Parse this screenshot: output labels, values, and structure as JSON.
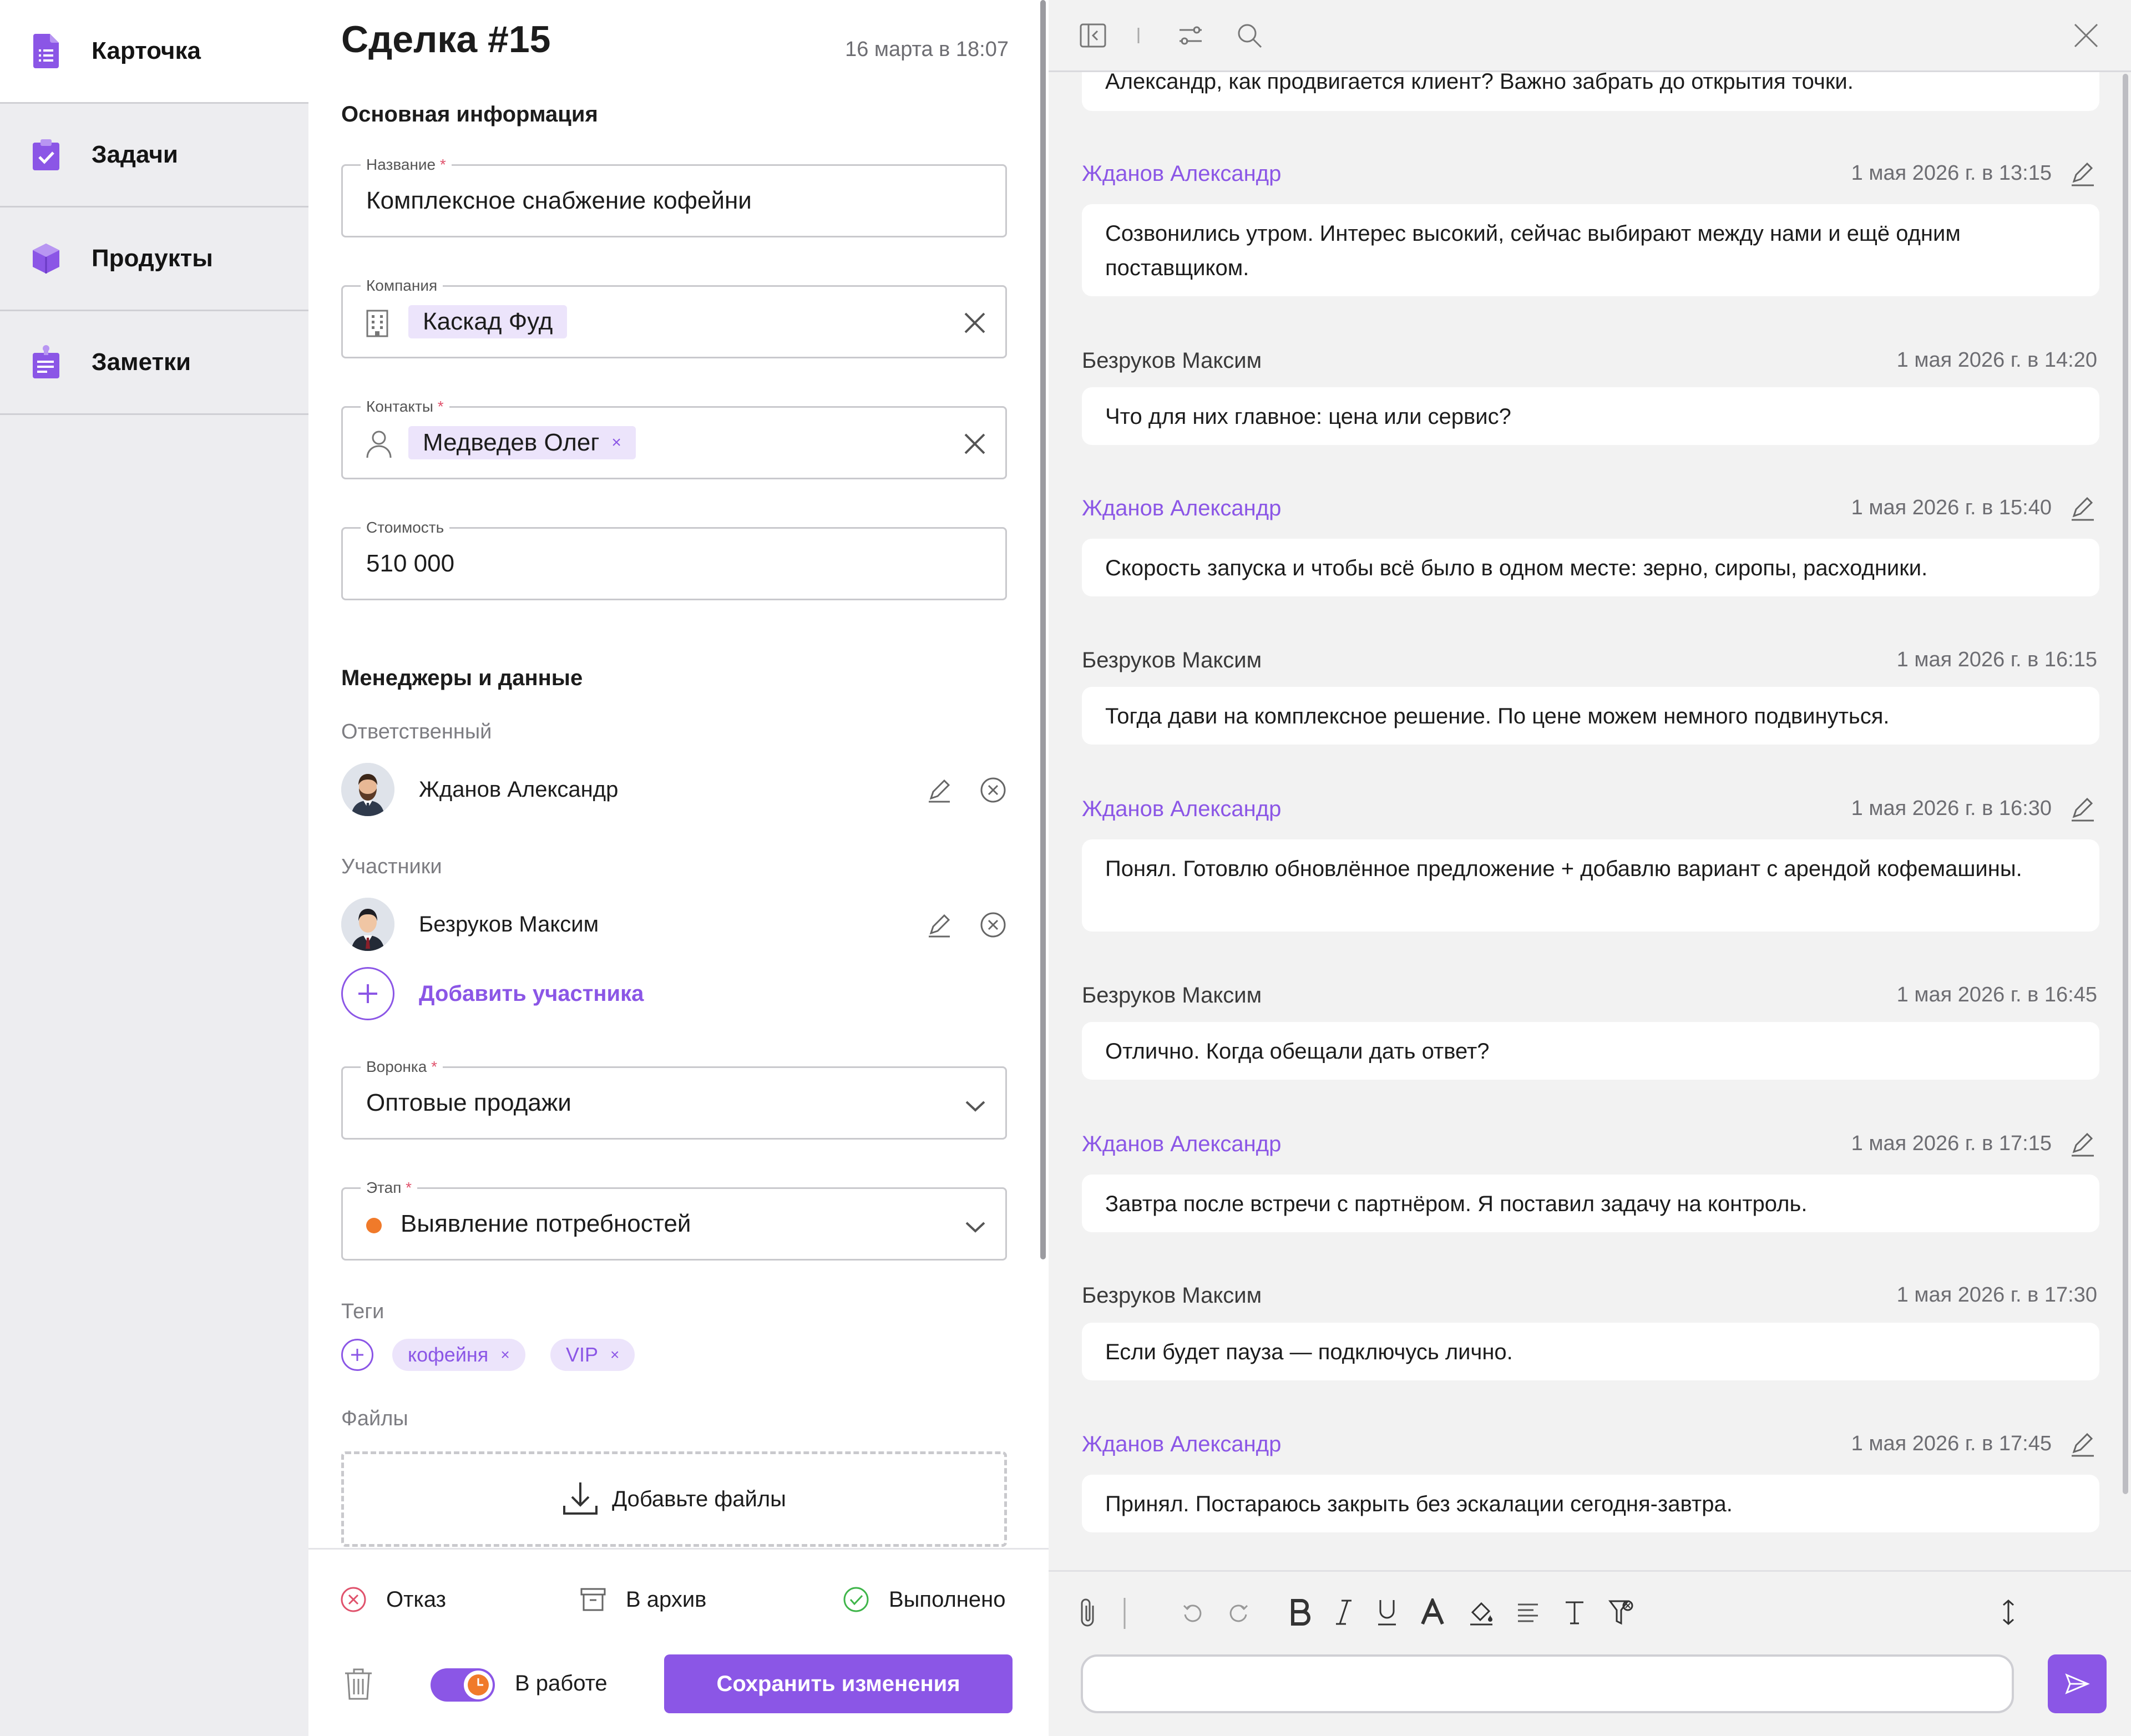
{
  "sidebar": {
    "items": [
      {
        "label": "Карточка",
        "icon": "card-icon"
      },
      {
        "label": "Задачи",
        "icon": "tasks-icon"
      },
      {
        "label": "Продукты",
        "icon": "products-icon"
      },
      {
        "label": "Заметки",
        "icon": "notes-icon"
      }
    ]
  },
  "deal": {
    "title": "Сделка #15",
    "created": "16 марта в 18:07",
    "section_main": "Основная информация",
    "name": {
      "label": "Название",
      "value": "Комплексное снабжение кофейни"
    },
    "company": {
      "label": "Компания",
      "value": "Каскад Фуд"
    },
    "contacts": {
      "label": "Контакты",
      "value": "Медведев Олег",
      "remove": "×"
    },
    "cost": {
      "label": "Стоимость",
      "value": "510 000"
    },
    "required_mark": "*",
    "section_managers": "Менеджеры и данные",
    "responsible_label": "Ответственный",
    "responsible": "Жданов Александр",
    "participants_label": "Участники",
    "participant": "Безруков Максим",
    "add_participant": "Добавить участника",
    "funnel": {
      "label": "Воронка",
      "value": "Оптовые продажи"
    },
    "stage": {
      "label": "Этап",
      "value": "Выявление потребностей",
      "dot_color": "#f07a2a"
    },
    "tags_label": "Теги",
    "tags": [
      {
        "label": "кофейня",
        "remove": "×"
      },
      {
        "label": "VIP",
        "remove": "×"
      }
    ],
    "files_label": "Файлы",
    "files_drop": "Добавьте файлы"
  },
  "footer": {
    "reject": "Отказ",
    "archive": "В архив",
    "done": "Выполнено",
    "status": "В работе",
    "save": "Сохранить изменения"
  },
  "chat": {
    "messages": [
      {
        "author": "",
        "me": false,
        "time": "",
        "text": "Александр, как продвигается клиент? Важно забрать до открытия точки.",
        "editable": false
      },
      {
        "author": "Жданов Александр",
        "me": true,
        "time": "1 мая 2026 г. в 13:15",
        "text": "Созвонились утром. Интерес высокий, сейчас выбирают между нами и ещё одним поставщиком.",
        "editable": true
      },
      {
        "author": "Безруков Максим",
        "me": false,
        "time": "1 мая 2026 г. в 14:20",
        "text": "Что для них главное: цена или сервис?",
        "editable": false
      },
      {
        "author": "Жданов Александр",
        "me": true,
        "time": "1 мая 2026 г. в 15:40",
        "text": "Скорость запуска и чтобы всё было в одном месте: зерно, сиропы, расходники.",
        "editable": true
      },
      {
        "author": "Безруков Максим",
        "me": false,
        "time": "1 мая 2026 г. в 16:15",
        "text": "Тогда дави на комплексное решение. По цене можем немного подвинуться.",
        "editable": false
      },
      {
        "author": "Жданов Александр",
        "me": true,
        "time": "1 мая 2026 г. в 16:30",
        "text": "Понял. Готовлю обновлённое предложение + добавлю вариант с арендой кофемашины.",
        "editable": true
      },
      {
        "author": "Безруков Максим",
        "me": false,
        "time": "1 мая 2026 г. в 16:45",
        "text": "Отлично. Когда обещали дать ответ?",
        "editable": false
      },
      {
        "author": "Жданов Александр",
        "me": true,
        "time": "1 мая 2026 г. в 17:15",
        "text": "Завтра после встречи с партнёром. Я поставил задачу на контроль.",
        "editable": true
      },
      {
        "author": "Безруков Максим",
        "me": false,
        "time": "1 мая 2026 г. в 17:30",
        "text": "Если будет пауза — подключусь лично.",
        "editable": false
      },
      {
        "author": "Жданов Александр",
        "me": true,
        "time": "1 мая 2026 г. в 17:45",
        "text": "Принял. Постараюсь закрыть без эскалации сегодня-завтра.",
        "editable": true
      }
    ],
    "composer_placeholder": ""
  },
  "colors": {
    "accent": "#8b56e6",
    "danger": "#e0526c",
    "success": "#3fb54a"
  }
}
